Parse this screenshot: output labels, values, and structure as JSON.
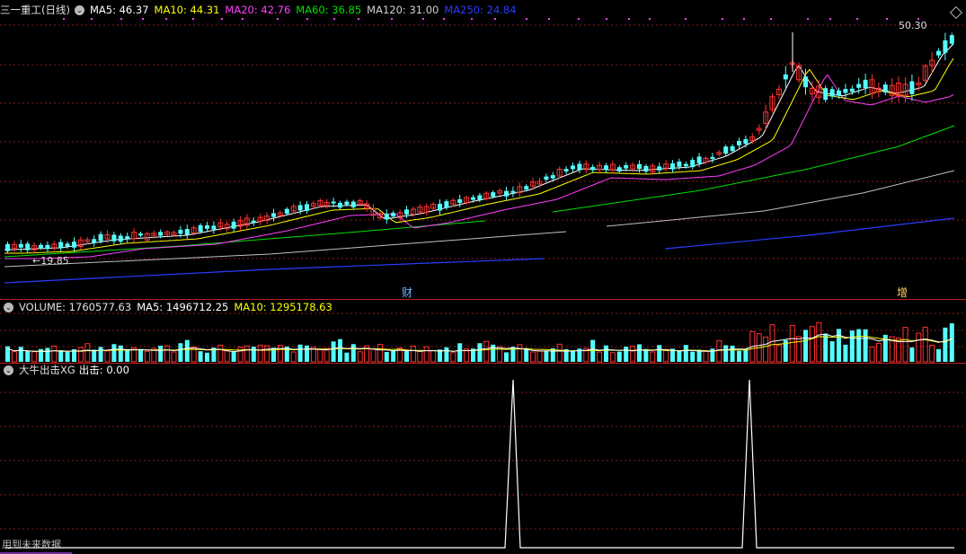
{
  "price_panel": {
    "stock_name": "三一重工(日线)",
    "ma5": "MA5: 46.37",
    "ma10": "MA10: 44.31",
    "ma20": "MA20: 42.76",
    "ma60": "MA60: 36.85",
    "ma120": "MA120: 31.00",
    "ma250": "MA250: 24.84",
    "high_label": "50.30",
    "low_label": "19.85",
    "marker_cai": "财",
    "marker_zeng": "增"
  },
  "volume_panel": {
    "volume": "VOLUME: 1760577.63",
    "ma5": "MA5: 1496712.25",
    "ma10": "MA10: 1295178.63"
  },
  "indicator_panel": {
    "name": "大牛出击XG",
    "value": "出击: 0.00",
    "footer": "用到未来数据"
  },
  "colors": {
    "up": "#ff3232",
    "down": "#54ffff",
    "ma5": "#ffffff",
    "ma10": "#ffff00",
    "ma20": "#ff40ff",
    "ma60": "#00e000",
    "ma120": "#c0c0c0",
    "ma250": "#2a3cff",
    "grid": "#8a1a1a"
  },
  "icons": [
    "collapse-circle-icon",
    "diamond-icon"
  ]
}
